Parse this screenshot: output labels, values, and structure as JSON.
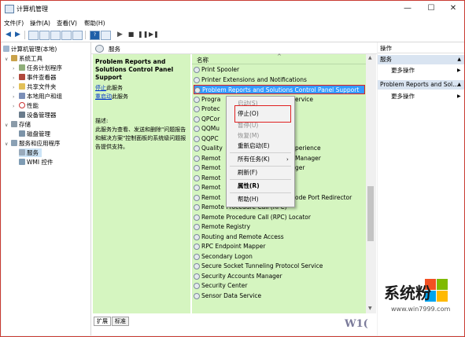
{
  "window": {
    "title": "计算机管理",
    "min": "—",
    "max": "☐",
    "close": "✕"
  },
  "menubar": [
    "文件(F)",
    "操作(A)",
    "查看(V)",
    "帮助(H)"
  ],
  "tree": {
    "root": "计算机管理(本地)",
    "system_tools": "系统工具",
    "task_scheduler": "任务计划程序",
    "event_viewer": "事件查看器",
    "shared_folders": "共享文件夹",
    "local_users": "本地用户和组",
    "performance": "性能",
    "device_manager": "设备管理器",
    "storage": "存储",
    "disk_management": "磁盘管理",
    "services_apps": "服务和应用程序",
    "services": "服务",
    "wmi": "WMI 控件"
  },
  "panel": {
    "header": "服务",
    "service_title": "Problem Reports and Solutions Control Panel Support",
    "stop_link": "停止",
    "stop_suffix": "此服务",
    "restart_link": "重启动",
    "restart_suffix": "此服务",
    "desc_label": "描述:",
    "desc_text": "此服务为查看、发送和删除\"问题报告和解决方案\"控制面板的系统级问题报告提供支持。",
    "column_name": "名称",
    "tab_extended": "扩展",
    "tab_standard": "标准"
  },
  "services": [
    "Print Spooler",
    "Printer Extensions and Notifications",
    "Problem Reports and Solutions Control Panel Support",
    "Program Compatibility Assistant Service",
    "Protected Storage",
    "QPCore Service",
    "QQMusic Service",
    "QQPCRTP",
    "Quality Windows Audio Video Experience",
    "Remote Access Auto Connection Manager",
    "Remote Access Connection Manager",
    "Remote Desktop Configuration",
    "Remote Desktop Services",
    "Remote Desktop Services UserMode Port Redirector",
    "Remote Procedure Call (RPC)",
    "Remote Procedure Call (RPC) Locator",
    "Remote Registry",
    "Routing and Remote Access",
    "RPC Endpoint Mapper",
    "Secondary Logon",
    "Secure Socket Tunneling Protocol Service",
    "Security Accounts Manager",
    "Security Center",
    "Sensor Data Service"
  ],
  "services_visible": [
    "Print Spooler",
    "Printer Extensions and Notifications",
    "Problem Reports and Solutions Control Panel Support",
    "Progra",
    "Protec",
    "QPCor",
    "QQMu",
    "QQPC",
    "Quality",
    "Remot",
    "Remot",
    "Remot",
    "Remot",
    "Remot",
    "Remote Procedure Call (RPC)",
    "Remote Procedure Call (RPC) Locator",
    "Remote Registry",
    "Routing and Remote Access",
    "RPC Endpoint Mapper",
    "Secondary Logon",
    "Secure Socket Tunneling Protocol Service",
    "Security Accounts Manager",
    "Security Center",
    "Sensor Data Service"
  ],
  "row_tails": {
    "3": "ervice",
    "8": "perience",
    "9": "Manager",
    "10": "ger",
    "13": "ode Port Redirector"
  },
  "context_menu": {
    "start": "启动(S)",
    "stop": "停止(O)",
    "pause": "暂停(U)",
    "resume": "恢复(M)",
    "restart": "重新启动(E)",
    "all_tasks": "所有任务(K)",
    "refresh": "刷新(F)",
    "properties": "属性(R)",
    "help": "帮助(H)"
  },
  "actions": {
    "title": "操作",
    "section1": "服务",
    "more1": "更多操作",
    "section2": "Problem Reports and Sol...",
    "more2": "更多操作"
  },
  "watermark": {
    "text": "系统粉",
    "url": "www.win7999.com",
    "partial": "W1("
  },
  "colors": {
    "selection": "#3399ff",
    "panel_green": "#d5f5c0",
    "highlight_border": "#e02020"
  }
}
